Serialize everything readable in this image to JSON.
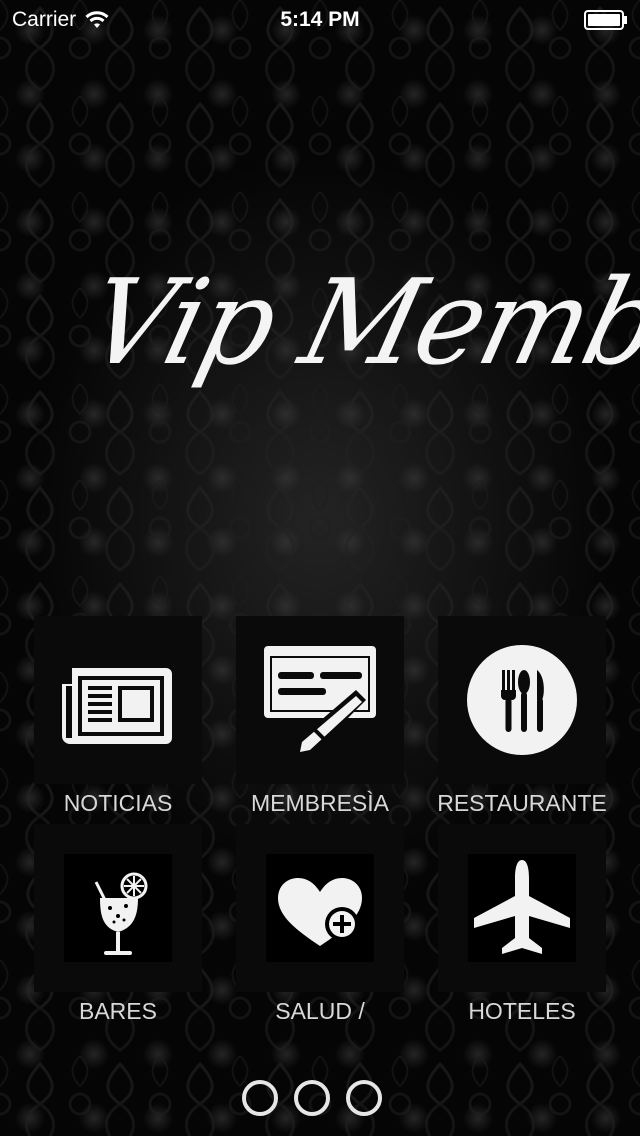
{
  "status_bar": {
    "carrier": "Carrier",
    "time": "5:14 PM"
  },
  "logo": {
    "text": "Vip Member"
  },
  "menu": {
    "items": [
      {
        "label": "NOTICIAS",
        "icon": "newspaper-icon"
      },
      {
        "label": "MEMBRESÌA",
        "icon": "membership-card-icon"
      },
      {
        "label": "RESTAURANTE",
        "icon": "restaurant-icon"
      },
      {
        "label": "BARES",
        "icon": "cocktail-icon"
      },
      {
        "label": "SALUD /",
        "icon": "health-heart-icon"
      },
      {
        "label": "HOTELES",
        "icon": "airplane-icon"
      }
    ]
  },
  "pager": {
    "page_count": 3
  },
  "colors": {
    "background": "#050505",
    "tile": "#0a0a0a",
    "icon": "#f2f2f2",
    "label": "#d8d8d8"
  }
}
